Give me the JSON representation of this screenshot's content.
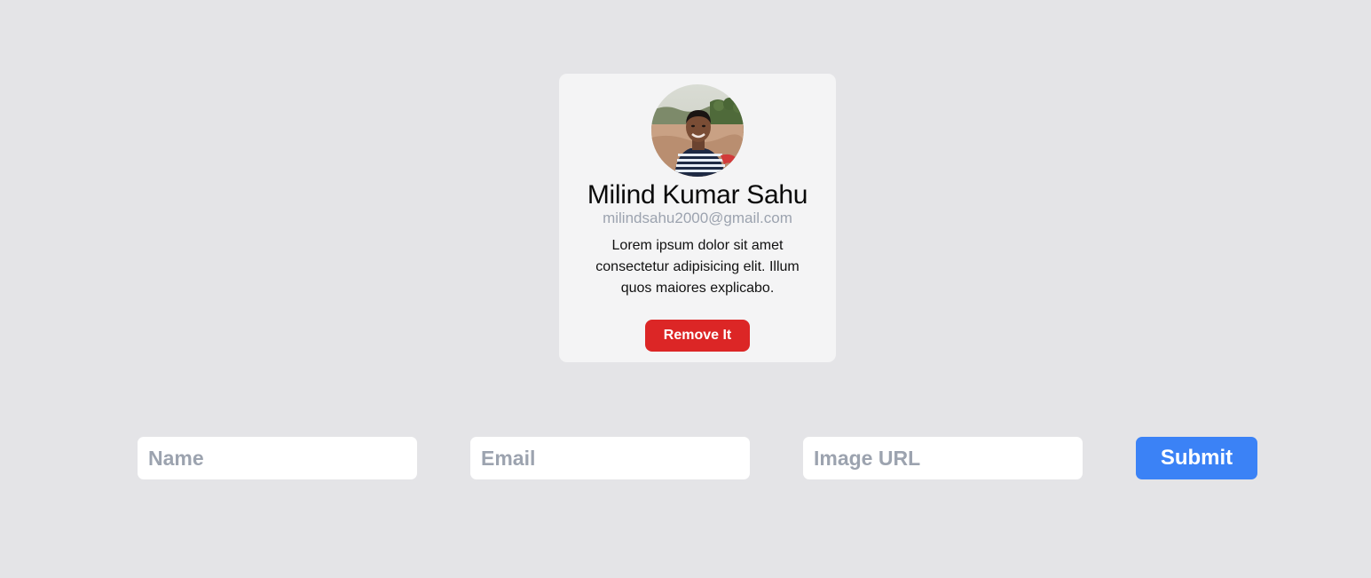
{
  "card": {
    "name": "Milind Kumar Sahu",
    "email": "milindsahu2000@gmail.com",
    "description": "Lorem ipsum dolor sit amet consectetur adipisicing elit. Illum quos maiores explicabo.",
    "remove_label": "Remove It"
  },
  "form": {
    "name_placeholder": "Name",
    "email_placeholder": "Email",
    "image_placeholder": "Image URL",
    "submit_label": "Submit"
  },
  "colors": {
    "background": "#e4e4e7",
    "card": "#f4f4f5",
    "remove_button": "#dc2626",
    "submit_button": "#3b82f6",
    "placeholder": "#9ca3af"
  }
}
